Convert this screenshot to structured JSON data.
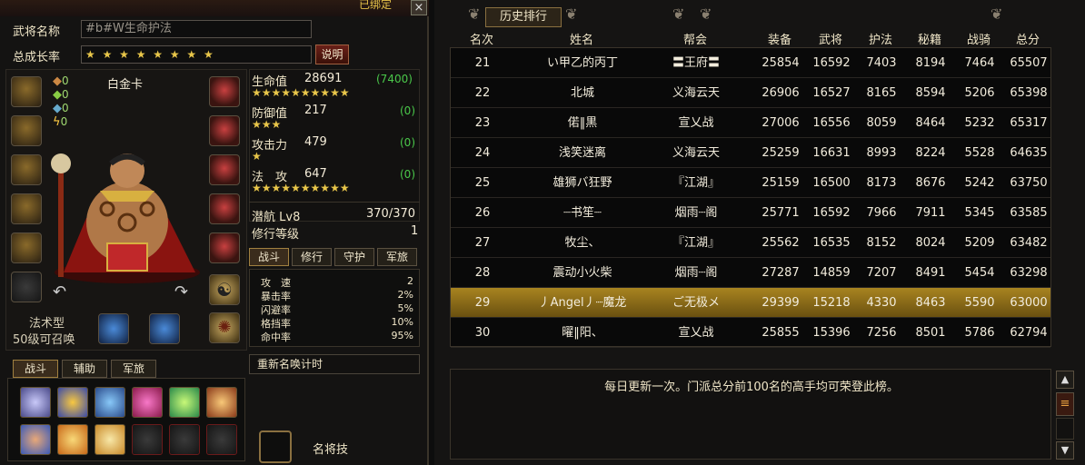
{
  "window": {
    "bound_text": "已绑定",
    "close_label": "×"
  },
  "general": {
    "name_label": "武将名称",
    "name_value": "#b#W生命护法",
    "growth_label": "总成长率",
    "growth_stars": "★ ★ ★ ★ ★ ★ ★ ★",
    "explain_label": "说明",
    "card_label": "白金卡",
    "counts": [
      "0",
      "0",
      "0",
      "0"
    ],
    "type_label": "法术型",
    "summon_label": "50级可召唤"
  },
  "stats": {
    "hp_label": "生命值",
    "hp_value": "28691",
    "hp_bonus": "(7400)",
    "hp_stars": "★★★★★★★★★★",
    "def_label": "防御值",
    "def_value": "217",
    "def_bonus": "(0)",
    "def_stars": "★★★",
    "atk_label": "攻击力",
    "atk_value": "479",
    "atk_bonus": "(0)",
    "atk_stars": "★",
    "mag_label": "法　攻",
    "mag_value": "647",
    "mag_bonus": "(0)",
    "mag_stars": "★★★★★★★★★★",
    "potential_label": "潜航 Lv8",
    "potential_value": "370/370",
    "cultivation_label": "修行等级",
    "cultivation_value": "1"
  },
  "stat_tabs": [
    "战斗",
    "修行",
    "守护",
    "军旅"
  ],
  "combat": [
    {
      "k": "攻　速",
      "v": "2"
    },
    {
      "k": "暴击率",
      "v": "2%"
    },
    {
      "k": "闪避率",
      "v": "5%"
    },
    {
      "k": "格挡率",
      "v": "10%"
    },
    {
      "k": "命中率",
      "v": "95%"
    }
  ],
  "rename_label": "重新名唤计时",
  "skill_tabs": [
    "战斗",
    "辅助",
    "军旅"
  ],
  "famous_skill_label": "名将技",
  "ranking": {
    "tab_label": "历史排行",
    "headers": [
      "名次",
      "姓名",
      "帮会",
      "装备",
      "武将",
      "护法",
      "秘籍",
      "战骑",
      "总分"
    ],
    "rows": [
      [
        "21",
        "い甲乙的丙丁",
        "〓王府〓",
        "25854",
        "16592",
        "7403",
        "8194",
        "7464",
        "65507"
      ],
      [
        "22",
        "北城",
        "义海云天",
        "26906",
        "16527",
        "8165",
        "8594",
        "5206",
        "65398"
      ],
      [
        "23",
        "偌‖黒",
        "宣乂战",
        "27006",
        "16556",
        "8059",
        "8464",
        "5232",
        "65317"
      ],
      [
        "24",
        "浅笑迷离",
        "义海云天",
        "25259",
        "16631",
        "8993",
        "8224",
        "5528",
        "64635"
      ],
      [
        "25",
        "雄狮バ狂野",
        "『江湖』",
        "25159",
        "16500",
        "8173",
        "8676",
        "5242",
        "63750"
      ],
      [
        "26",
        "┈书笙┈",
        "烟雨┈阁",
        "25771",
        "16592",
        "7966",
        "7911",
        "5345",
        "63585"
      ],
      [
        "27",
        "牧尘、",
        "『江湖』",
        "25562",
        "16535",
        "8152",
        "8024",
        "5209",
        "63482"
      ],
      [
        "28",
        "震动小火柴",
        "烟雨┈阁",
        "27287",
        "14859",
        "7207",
        "8491",
        "5454",
        "63298"
      ],
      [
        "29",
        "丿Angel丿┈魔龙",
        "ご无极メ",
        "29399",
        "15218",
        "4330",
        "8463",
        "5590",
        "63000"
      ],
      [
        "30",
        "曜‖阳、",
        "宣乂战",
        "25855",
        "15396",
        "7256",
        "8501",
        "5786",
        "62794"
      ]
    ],
    "highlight_rank": "29",
    "message": "每日更新一次。门派总分前100名的高手均可荣登此榜。"
  },
  "colors": {
    "gold": "#e8c64a",
    "highlight": "#a88420",
    "green": "#4ac84a"
  }
}
